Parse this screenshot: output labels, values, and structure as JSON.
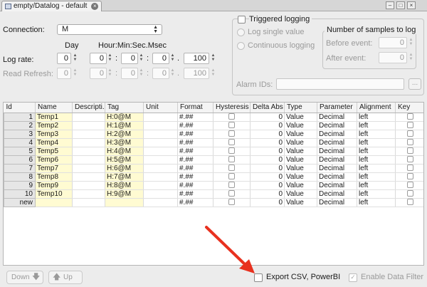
{
  "tab": {
    "title": "empty/Datalog - default"
  },
  "connection": {
    "label": "Connection:",
    "value": "M"
  },
  "time_headers": {
    "day": "Day",
    "hms": "Hour:Min:Sec.Msec"
  },
  "log_rate": {
    "label": "Log rate:",
    "day": "0",
    "hour": "0",
    "min": "0",
    "sec": "0",
    "msec": "100"
  },
  "read_refresh": {
    "label": "Read Refresh:",
    "day": "0",
    "hour": "0",
    "min": "0",
    "sec": "0",
    "msec": "100"
  },
  "separators": {
    "colon": ":",
    "dot": "."
  },
  "triggered": {
    "label": "Triggered logging",
    "log_single": "Log single value",
    "continuous": "Continuous logging",
    "samples_title": "Number of samples to log",
    "before_label": "Before event:",
    "before_value": "0",
    "after_label": "After event:",
    "after_value": "0",
    "alarm_label": "Alarm IDs:",
    "alarm_btn": "..."
  },
  "table": {
    "columns": [
      "Id",
      "Name",
      "Descripti...",
      "Tag",
      "Unit",
      "Format",
      "Hysteresis",
      "Delta Abs",
      "Type",
      "Parameter",
      "Alignment",
      "Key"
    ],
    "rows": [
      {
        "id": "1",
        "name": "Temp1",
        "tag": "H:0@M",
        "format": "#.##",
        "delta": "0",
        "type": "Value",
        "param": "Decimal",
        "align": "left"
      },
      {
        "id": "2",
        "name": "Temp2",
        "tag": "H:1@M",
        "format": "#.##",
        "delta": "0",
        "type": "Value",
        "param": "Decimal",
        "align": "left"
      },
      {
        "id": "3",
        "name": "Temp3",
        "tag": "H:2@M",
        "format": "#.##",
        "delta": "0",
        "type": "Value",
        "param": "Decimal",
        "align": "left"
      },
      {
        "id": "4",
        "name": "Temp4",
        "tag": "H:3@M",
        "format": "#.##",
        "delta": "0",
        "type": "Value",
        "param": "Decimal",
        "align": "left"
      },
      {
        "id": "5",
        "name": "Temp5",
        "tag": "H:4@M",
        "format": "#.##",
        "delta": "0",
        "type": "Value",
        "param": "Decimal",
        "align": "left"
      },
      {
        "id": "6",
        "name": "Temp6",
        "tag": "H:5@M",
        "format": "#.##",
        "delta": "0",
        "type": "Value",
        "param": "Decimal",
        "align": "left"
      },
      {
        "id": "7",
        "name": "Temp7",
        "tag": "H:6@M",
        "format": "#.##",
        "delta": "0",
        "type": "Value",
        "param": "Decimal",
        "align": "left"
      },
      {
        "id": "8",
        "name": "Temp8",
        "tag": "H:7@M",
        "format": "#.##",
        "delta": "0",
        "type": "Value",
        "param": "Decimal",
        "align": "left"
      },
      {
        "id": "9",
        "name": "Temp9",
        "tag": "H:8@M",
        "format": "#.##",
        "delta": "0",
        "type": "Value",
        "param": "Decimal",
        "align": "left"
      },
      {
        "id": "10",
        "name": "Temp10",
        "tag": "H:9@M",
        "format": "#.##",
        "delta": "0",
        "type": "Value",
        "param": "Decimal",
        "align": "left"
      },
      {
        "id": "new",
        "name": "",
        "tag": "",
        "format": "#.##",
        "delta": "0",
        "type": "Value",
        "param": "Decimal",
        "align": "left"
      }
    ]
  },
  "bottom": {
    "down": "Down",
    "up": "Up",
    "export": "Export CSV, PowerBI",
    "filter": "Enable Data Filter",
    "filter_check": "✓"
  },
  "icons": {
    "tab": "tab-icon",
    "close": "close-icon",
    "down": "arrow-down-icon",
    "up": "arrow-up-icon",
    "annotation": "red-arrow-icon"
  },
  "colors": {
    "annotation": "#e8311f",
    "yellow_cell": "#fffbd2"
  }
}
